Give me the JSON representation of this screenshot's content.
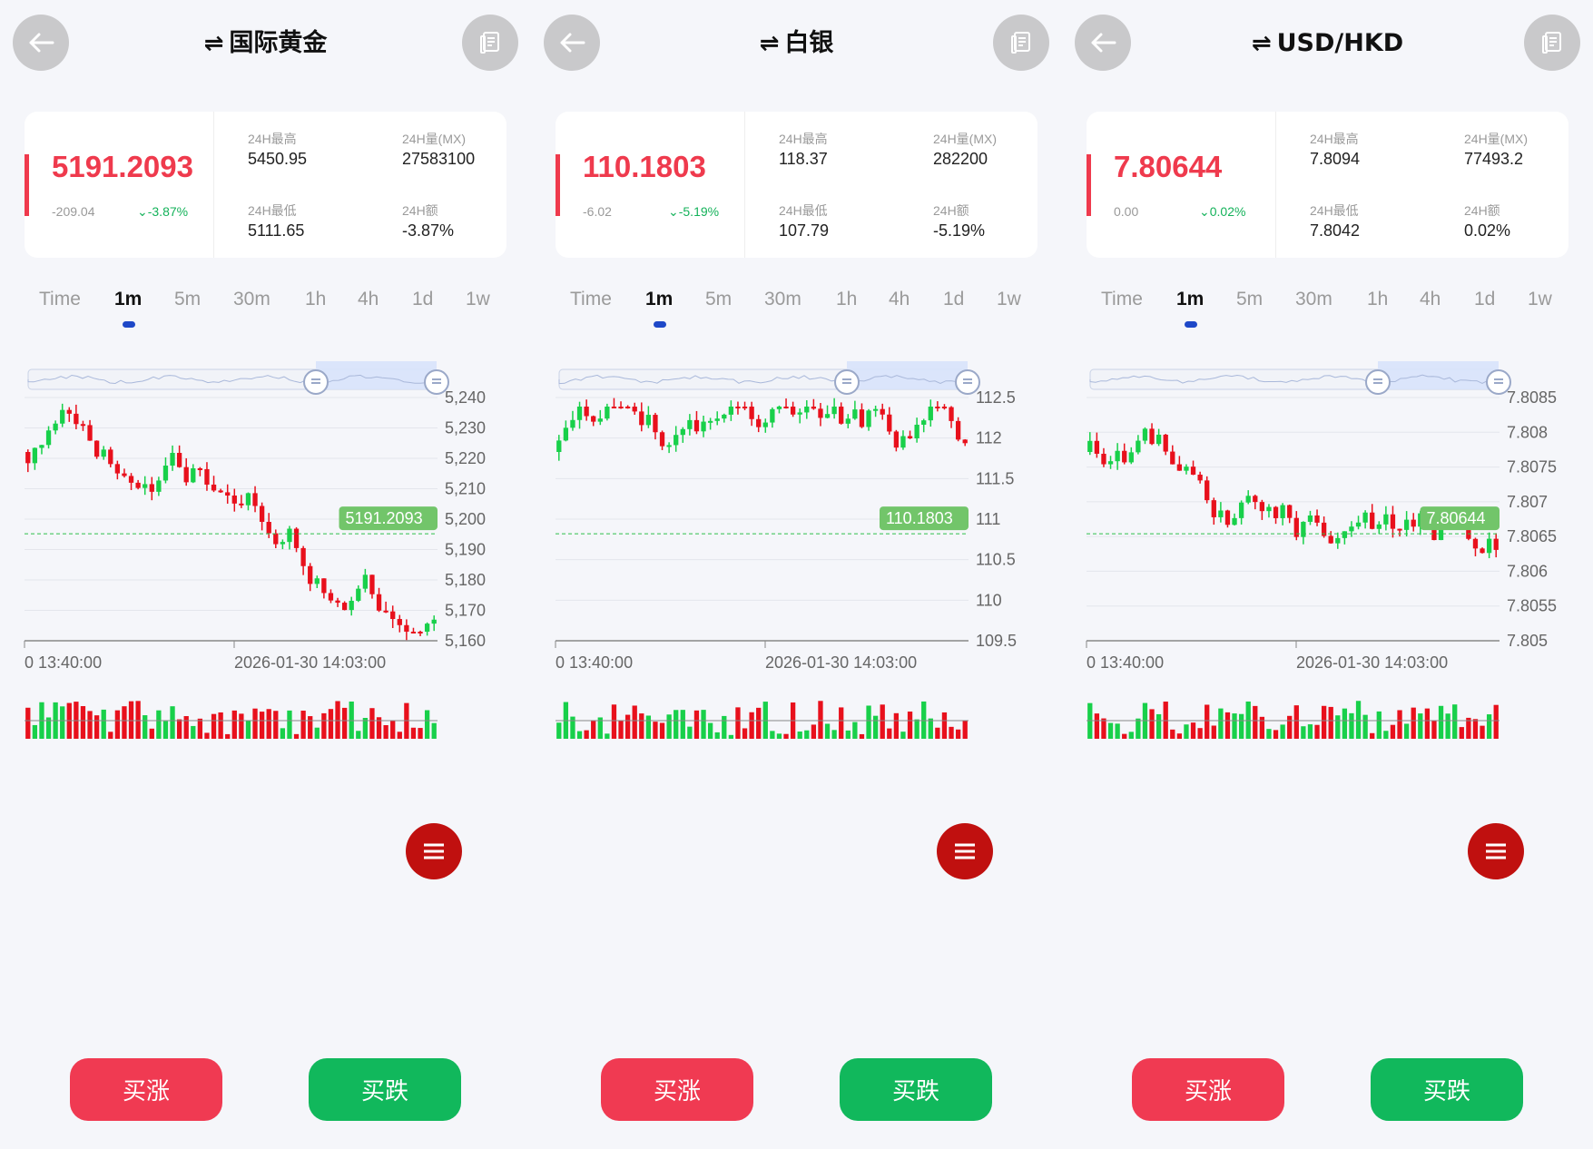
{
  "panels": [
    {
      "title": "国际黄金",
      "swap_icon": "⇌",
      "price": "5191.2093",
      "change": "-209.04",
      "change_pct": "-3.87%",
      "stats": [
        {
          "label": "24H最高",
          "value": "5450.95"
        },
        {
          "label": "24H量(MX)",
          "value": "27583100"
        },
        {
          "label": "24H最低",
          "value": "5111.65"
        },
        {
          "label": "24H额",
          "value": "-3.87%"
        }
      ],
      "tabs": [
        "Time",
        "1m",
        "5m",
        "30m",
        "1h",
        "4h",
        "1d",
        "1w"
      ],
      "active_tab": "1m",
      "buttons": {
        "up": "买涨",
        "down": "买跌"
      },
      "chart": {
        "y_ticks": [
          "5,240",
          "5,230",
          "5,220",
          "5,210",
          "5,200",
          "5,190",
          "5,180",
          "5,170",
          "5,160"
        ],
        "x_ticks": [
          "0 13:40:00",
          "2026-01-30 14:03:00"
        ],
        "price_tag": "5191.2093"
      }
    },
    {
      "title": "白银",
      "swap_icon": "⇌",
      "price": "110.1803",
      "change": "-6.02",
      "change_pct": "-5.19%",
      "stats": [
        {
          "label": "24H最高",
          "value": "118.37"
        },
        {
          "label": "24H量(MX)",
          "value": "282200"
        },
        {
          "label": "24H最低",
          "value": "107.79"
        },
        {
          "label": "24H额",
          "value": "-5.19%"
        }
      ],
      "tabs": [
        "Time",
        "1m",
        "5m",
        "30m",
        "1h",
        "4h",
        "1d",
        "1w"
      ],
      "active_tab": "1m",
      "buttons": {
        "up": "买涨",
        "down": "买跌"
      },
      "chart": {
        "y_ticks": [
          "112.5",
          "112",
          "111.5",
          "111",
          "110.5",
          "110",
          "109.5"
        ],
        "x_ticks": [
          "0 13:40:00",
          "2026-01-30 14:03:00"
        ],
        "price_tag": "110.1803"
      }
    },
    {
      "title": "USD/HKD",
      "swap_icon": "⇌",
      "price": "7.80644",
      "change": "0.00",
      "change_pct": "0.02%",
      "stats": [
        {
          "label": "24H最高",
          "value": "7.8094"
        },
        {
          "label": "24H量(MX)",
          "value": "77493.2"
        },
        {
          "label": "24H最低",
          "value": "7.8042"
        },
        {
          "label": "24H额",
          "value": "0.02%"
        }
      ],
      "tabs": [
        "Time",
        "1m",
        "5m",
        "30m",
        "1h",
        "4h",
        "1d",
        "1w"
      ],
      "active_tab": "1m",
      "buttons": {
        "up": "买涨",
        "down": "买跌"
      },
      "chart": {
        "y_ticks": [
          "7.8085",
          "7.808",
          "7.8075",
          "7.807",
          "7.8065",
          "7.806",
          "7.8055",
          "7.805"
        ],
        "x_ticks": [
          "0 13:40:00",
          "2026-01-30 14:03:00"
        ],
        "price_tag": "7.80644"
      }
    }
  ],
  "colors": {
    "up": "#e8101c",
    "down": "#18d04a",
    "accent": "#ef3a4d",
    "tab_indicator": "#1e48c8",
    "price_tag": "#72c56a"
  }
}
